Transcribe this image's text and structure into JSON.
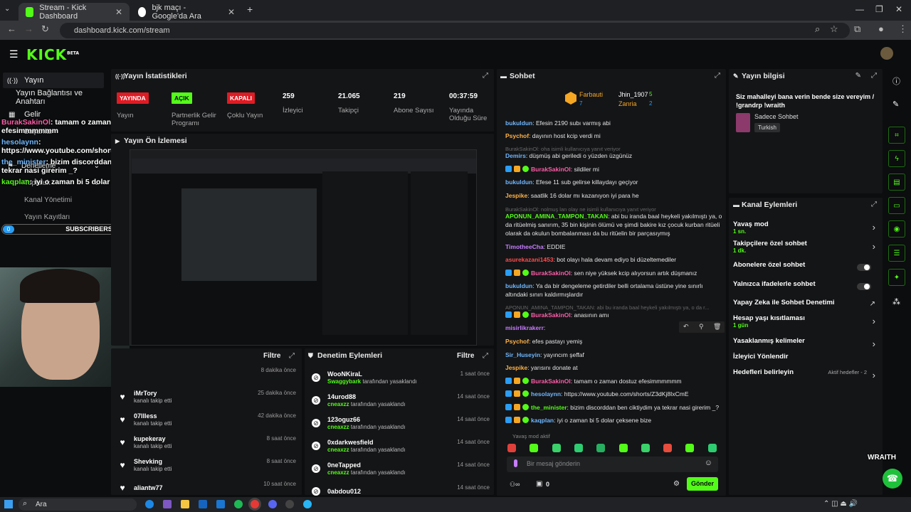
{
  "browser": {
    "tabs": [
      {
        "title": "Stream - Kick Dashboard"
      },
      {
        "title": "bjk maçı - Google'da Ara"
      }
    ],
    "url": "dashboard.kick.com/stream"
  },
  "sidebar": {
    "items": [
      "Yayın",
      "Yayın Bağlantısı ve Anahtarı",
      "Gelir",
      "Başarılar",
      "Denetleme",
      "Topluluk",
      "Kanal Yönetimi",
      "Yayın Kayıtları"
    ]
  },
  "overlay": {
    "chat": [
      {
        "u": "BurakSakinOl",
        "t": ": tamam o zaman dostuz efesimmmmmm"
      },
      {
        "u": "hesolaynn",
        "t": ": https://www.youtube.com/shorts/Z3dKj8IxCmE"
      },
      {
        "u": "the_minister",
        "t": ": bizim discorddan ben ciktiydim ya tekrar nasi girerim _?"
      },
      {
        "u": "kaqplan",
        "t": ": iyi o zaman bi 5 dolar çeksene bize"
      }
    ],
    "sub_count": "0",
    "sub_label": "SUBSCRIBERS"
  },
  "stats": {
    "title": "Yayın İstatistikleri",
    "items": [
      {
        "v": "YAYINDA",
        "l": "Yayın",
        "c": "#e01b24"
      },
      {
        "v": "AÇIK",
        "l": "Partnerlik Gelir Programı",
        "c": "#53fc18"
      },
      {
        "v": "KAPALI",
        "l": "Çoklu Yayın",
        "c": "#e01b24"
      },
      {
        "v": "259",
        "l": "İzleyici"
      },
      {
        "v": "21.065",
        "l": "Takipçi"
      },
      {
        "v": "219",
        "l": "Abone Sayısı"
      },
      {
        "v": "00:37:59",
        "l": "Yayında Olduğu Süre"
      }
    ]
  },
  "preview": {
    "title": "Yayın Ön İzlemesi"
  },
  "activity": {
    "filter": "Filtre",
    "items": [
      {
        "n": "",
        "s": "",
        "t": "8 dakika önce"
      },
      {
        "n": "iMrTory",
        "s": "kanalı takip etti",
        "t": "25 dakika önce"
      },
      {
        "n": "07llless",
        "s": "kanalı takip etti",
        "t": "42 dakika önce"
      },
      {
        "n": "kupekeray",
        "s": "kanalı takip etti",
        "t": "8 saat önce"
      },
      {
        "n": "Shevking",
        "s": "kanalı takip etti",
        "t": "8 saat önce"
      },
      {
        "n": "aliantw77",
        "s": "",
        "t": "10 saat önce"
      }
    ]
  },
  "moderation": {
    "title": "Denetim Eylemleri",
    "filter": "Filtre",
    "items": [
      {
        "n": "WooNKiraL",
        "by": "Swaggybark",
        "s": "tarafından yasaklandı",
        "t": "1 saat önce"
      },
      {
        "n": "14urod88",
        "by": "cneaxzz",
        "s": "tarafından yasaklandı",
        "t": "14 saat önce"
      },
      {
        "n": "123oguz66",
        "by": "cneaxzz",
        "s": "tarafından yasaklandı",
        "t": "14 saat önce"
      },
      {
        "n": "0xdarkwesfield",
        "by": "cneaxzz",
        "s": "tarafından yasaklandı",
        "t": "14 saat önce"
      },
      {
        "n": "0neTapped",
        "by": "cneaxzz",
        "s": "tarafından yasaklandı",
        "t": "14 saat önce"
      },
      {
        "n": "0abdou012",
        "by": "",
        "s": "",
        "t": "14 saat önce"
      }
    ]
  },
  "chat": {
    "title": "Sohbet",
    "leaders": [
      {
        "n": "Farbauti",
        "c": "7"
      },
      {
        "n": "Jhin_1907",
        "c": "5"
      },
      {
        "n": "Zanria",
        "c": "2"
      }
    ],
    "messages": [
      {
        "u": "bukuldun",
        "c": "#6eb7ff",
        "t": ": Efesin 2190 subı varmış abi"
      },
      {
        "u": "Psychof",
        "c": "#ffb347",
        "t": ": dayının host kcip verdi mi"
      },
      {
        "reply": "BurakSakinOl: oha isimli kullanıcıya yanıt veriyor"
      },
      {
        "u": "Demirs",
        "c": "#6eb7ff",
        "t": ": düşmüş abi geriledi o yüzden üzgünüz"
      },
      {
        "u": "BurakSakinOl",
        "c": "#ff5ca8",
        "t": ": sildiler mi"
      },
      {
        "u": "bukuldun",
        "c": "#6eb7ff",
        "t": ": Efese 11 sub gelirse killaydayı geçiyor"
      },
      {
        "u": "Jespike",
        "c": "#ffb347",
        "t": ": saatlik 16 dolar mı kazanıyon iyi para he"
      },
      {
        "reply": "BurakSakinOl: nolmuş lan olay ne isimli kullanıcıya yanıt veriyor"
      },
      {
        "u": "APONUN_AMINA_TAMPON_TAKAN",
        "c": "#53fc18",
        "t": ": abi bu iranda baal heykeli yakılmıştı ya, o da ritüelmiş sanırım, 35 bin kişinin ölümü ve şimdi bakire kız çocuk kurban ritüeli olarak da okulun bombalanması da bu ritüelin bir parçasıymış"
      },
      {
        "u": "TimotheeCha",
        "c": "#c77dff",
        "t": ": EDDIE"
      },
      {
        "u": "asurekazani1453",
        "c": "#ff4d4d",
        "t": ": bot olayı hala devam ediyo bi düzeltemediler"
      },
      {
        "u": "BurakSakinOl",
        "c": "#ff5ca8",
        "t": ": sen niye yüksek kcip alıyorsun artık düşmanız"
      },
      {
        "u": "bukuldun",
        "c": "#6eb7ff",
        "t": ": Ya da bir dengeleme getirdiler belli ortalama üstüne yine sınırlı altındaki sınırı kaldırmışlardır"
      },
      {
        "reply": "APONUN_AMINA_TAMPON_TAKAN: abi bu iranda baal heykeli yakılmıştı ya, o da r..."
      },
      {
        "u": "BurakSakinOl",
        "c": "#ff5ca8",
        "t": ": anasının amı"
      },
      {
        "u": "misirlikrakerr",
        "c": "#c77dff",
        "t": ":"
      },
      {
        "u": "Psychof",
        "c": "#ffb347",
        "t": ": efes pastayı yemiş"
      },
      {
        "u": "Sir_Huseyin",
        "c": "#6eb7ff",
        "t": ": yayıncım şeffaf"
      },
      {
        "u": "Jespike",
        "c": "#ffb347",
        "t": ": yarısını donate at"
      },
      {
        "u": "BurakSakinOl",
        "c": "#ff5ca8",
        "t": ": tamam o zaman dostuz efesimmmmmm"
      },
      {
        "u": "hesolaynn",
        "c": "#6eb7ff",
        "t": ": https://www.youtube.com/shorts/Z3dKj8IxCmE"
      },
      {
        "u": "the_minister",
        "c": "#53fc18",
        "t": ": bizim discorddan ben ciktiydim ya tekrar nasi girerim _?"
      },
      {
        "u": "kaqplan",
        "c": "#6eb7ff",
        "t": ": iyi o zaman bi 5 dolar çeksene bize"
      }
    ],
    "slow_mode": "Yavaş mod aktif",
    "placeholder": "Bir mesaj gönderin",
    "send": "Gönder",
    "count": "0"
  },
  "info": {
    "title": "Yayın bilgisi",
    "stream_title": "Siz mahalleyi bana verin bende size vereyim / !grandrp !wraith",
    "category": "Sadece Sohbet",
    "tag": "Turkish"
  },
  "channel": {
    "title": "Kanal Eylemleri",
    "rows": [
      {
        "l": "Yavaş mod",
        "s": "1 sn.",
        "k": "chev"
      },
      {
        "l": "Takipçilere özel sohbet",
        "s": "1 dk.",
        "k": "chev"
      },
      {
        "l": "Abonelere özel sohbet",
        "s": "",
        "k": "toggle"
      },
      {
        "l": "Yalnızca ifadelerle sohbet",
        "s": "",
        "k": "toggle"
      },
      {
        "l": "Yapay Zeka ile Sohbet Denetimi",
        "s": "",
        "k": "link"
      },
      {
        "l": "Hesap yaşı kısıtlaması",
        "s": "1 gün",
        "k": "chev"
      },
      {
        "l": "Yasaklanmış kelimeler",
        "s": "",
        "k": "chev"
      },
      {
        "l": "İzleyici Yönlendir",
        "s": "",
        "k": "none"
      },
      {
        "l": "Hedefleri belirleyin",
        "s": "",
        "k": "chev",
        "extra": "Aktif hedefler - 2"
      }
    ]
  },
  "taskbar": {
    "search": "Ara"
  },
  "watermark": "WRAITH"
}
